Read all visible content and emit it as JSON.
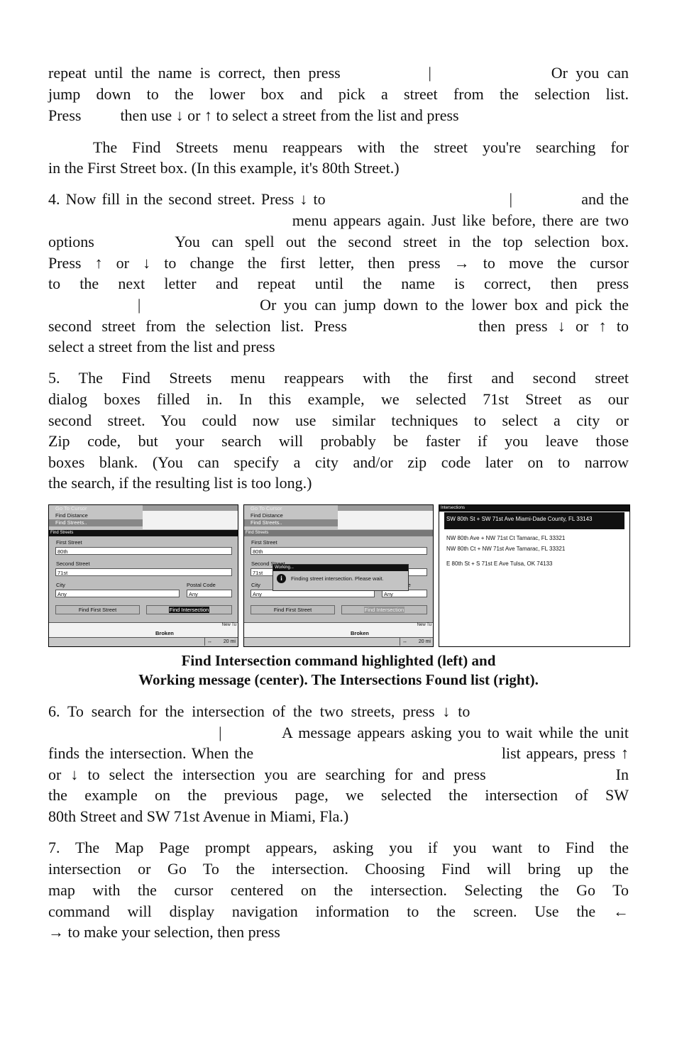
{
  "paragraphs": [
    {
      "lines": [
        {
          "t": "repeat until the name is correct, then press           |               Or you can",
          "j": true
        },
        {
          "t": "jump down to the lower box and pick a street from the selection list.",
          "j": true
        },
        {
          "t": "Press          then use ↓ or ↑ to select a street from the list and press",
          "j": false
        }
      ]
    },
    {
      "lines": [
        {
          "t": "   The Find Streets menu reappears with the street you're searching for",
          "j": true
        },
        {
          "t": "in the First Street box. (In this example, it's 80th Street.)",
          "j": false
        }
      ]
    },
    {
      "lines": [
        {
          "t": "4. Now fill in the second street. Press ↓ to                                |            and the",
          "j": true
        },
        {
          "t": "                                      menu appears again. Just like before, there are two",
          "j": true
        },
        {
          "t": "options       You can spell out the second street in the top selection box.",
          "j": true
        },
        {
          "t": "Press ↑ or ↓ to change the first letter, then press → to move the cursor",
          "j": true
        },
        {
          "t": "to the next letter and repeat until the name is correct, then press",
          "j": true
        },
        {
          "t": "            |                Or you can jump down to the lower box and pick the",
          "j": true
        },
        {
          "t": "second street from the selection list. Press             then press ↓ or ↑ to",
          "j": true
        },
        {
          "t": "select a street from the list and press",
          "j": false
        }
      ]
    },
    {
      "lines": [
        {
          "t": "5. The Find Streets menu reappears with the first and second street",
          "j": true
        },
        {
          "t": "dialog boxes filled in. In this example, we selected 71st Street as our",
          "j": true
        },
        {
          "t": "second street. You could now use similar techniques to select a city or",
          "j": true
        },
        {
          "t": "Zip code, but your search will probably be faster if you leave those",
          "j": true
        },
        {
          "t": "boxes blank. (You can specify a city and/or zip code later on to narrow",
          "j": true
        },
        {
          "t": "the search, if the resulting list is too long.)",
          "j": false
        }
      ]
    },
    {
      "lines": [
        {
          "t": "6. To search for the intersection of the two streets, press ↓ to                     ",
          "j": true
        },
        {
          "t": "                            |          A message appears asking you to wait while the unit",
          "j": true
        },
        {
          "t": "finds the intersection. When the                                             list appears, press ↑",
          "j": true
        },
        {
          "t": "or ↓ to select the intersection you are searching for and press              In",
          "j": true
        },
        {
          "t": "the example on the previous page, we selected the intersection of SW",
          "j": true
        },
        {
          "t": "80th Street and SW 71st Avenue in Miami, Fla.)",
          "j": false
        }
      ]
    },
    {
      "lines": [
        {
          "t": "7. The Map Page prompt appears, asking you if you want to Find the",
          "j": true
        },
        {
          "t": "intersection or Go To the intersection. Choosing Find will bring up the",
          "j": true
        },
        {
          "t": "map with the cursor centered on the intersection. Selecting the Go To",
          "j": true
        },
        {
          "t": "command will display navigation information to the screen. Use the ←",
          "j": true
        },
        {
          "t": "→ to make your selection, then press",
          "j": false
        }
      ]
    }
  ],
  "caption": [
    "Find Intersection command highlighted (left) and",
    "Working message (center). The Intersections Found list (right)."
  ],
  "screen": {
    "menu": [
      "Go To Cursor",
      "Find Distance",
      "Find Streets.."
    ],
    "dialog_title": "Find Streets",
    "first_street_label": "First Street",
    "first_street": "80th",
    "second_street_label": "Second Street",
    "second_street": "71st",
    "city_label": "City",
    "city": "Any",
    "postal_label": "Postal Code",
    "postal": "Any",
    "btn_first": "Find First Street",
    "btn_intersection": "Find Intersection",
    "map_label": "Broken",
    "map_label2": "New Tu",
    "scale": "20 mi",
    "working_title": "Working...",
    "working_msg": "Finding street intersection.  Please wait."
  },
  "intersections": {
    "title": "Intersections",
    "items": [
      "SW 80th St + SW 71st Ave Miami-Dade County, FL  33143",
      "NW 80th Ave + NW 71st Ct Tamarac, FL  33321",
      "NW 80th Ct + NW 71st Ave Tamarac, FL  33321",
      "E 80th St + S 71st E Ave Tulsa, OK  74133"
    ]
  }
}
